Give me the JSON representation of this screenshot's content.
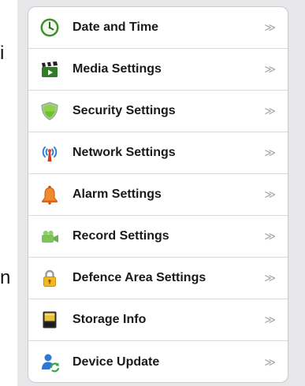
{
  "edge_text": {
    "left_top": "i",
    "left_bottom": "n"
  },
  "chevron_glyph": "≫",
  "menu": {
    "items": [
      {
        "label": "Date and Time",
        "icon": "clock-icon"
      },
      {
        "label": "Media Settings",
        "icon": "clapperboard-icon"
      },
      {
        "label": "Security Settings",
        "icon": "shield-icon"
      },
      {
        "label": "Network Settings",
        "icon": "antenna-icon"
      },
      {
        "label": "Alarm Settings",
        "icon": "bell-icon"
      },
      {
        "label": "Record Settings",
        "icon": "camcorder-icon"
      },
      {
        "label": "Defence Area Settings",
        "icon": "padlock-icon"
      },
      {
        "label": "Storage Info",
        "icon": "sd-card-icon"
      },
      {
        "label": "Device Update",
        "icon": "user-sync-icon"
      }
    ]
  },
  "colors": {
    "backdrop": "#e7e7ea",
    "panel": "#ffffff",
    "divider": "#d9d9dd",
    "label": "#1a1a1a",
    "chevron": "#a8a8ad"
  }
}
